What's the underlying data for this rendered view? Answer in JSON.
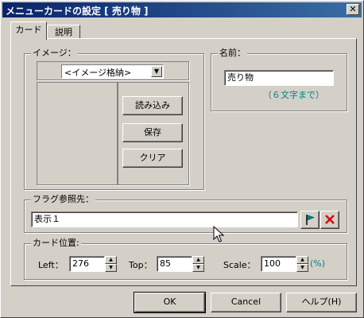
{
  "window": {
    "title": "メニューカードの設定 [ 売り物 ]",
    "close_glyph": "✕"
  },
  "tabs": [
    {
      "label": "カード"
    },
    {
      "label": "説明"
    }
  ],
  "image_group": {
    "label": "イメージ：",
    "combo_value": "<イメージ格納>",
    "load_button": "読み込み",
    "save_button": "保存",
    "clear_button": "クリア"
  },
  "name_group": {
    "label": "名前：",
    "value": "売り物",
    "hint": "（６文字まで）"
  },
  "flag_group": {
    "label": "フラグ参照先：",
    "value": "表示１"
  },
  "position_group": {
    "label": "カード位置:",
    "left_label": "Left：",
    "left_value": "276",
    "top_label": "Top：",
    "top_value": "85",
    "scale_label": "Scale：",
    "scale_value": "100",
    "scale_unit": "(%)"
  },
  "footer": {
    "ok": "OK",
    "cancel": "Cancel",
    "help": "ヘルプ(H)"
  },
  "colors": {
    "hint_teal": "#008080",
    "flag_red": "#d01010",
    "flag_teal": "#008080"
  },
  "icons": {
    "flag": "flag-icon",
    "delete": "x-icon",
    "cursor": "mouse-pointer-icon"
  }
}
